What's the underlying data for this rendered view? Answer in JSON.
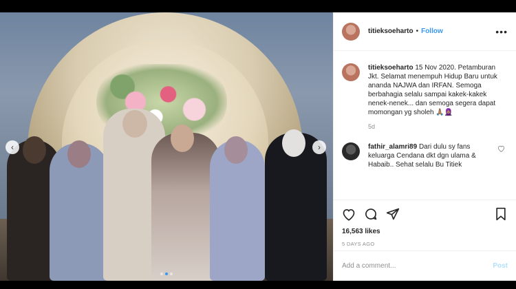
{
  "post": {
    "username": "titieksoeharto",
    "follow_label": "Follow",
    "more_label": "•••",
    "separator": "•"
  },
  "caption": {
    "username": "titieksoeharto",
    "text": "15 Nov 2020. Petamburan Jkt. Selamat menempuh Hidup Baru untuk ananda NAJWA dan IRFAN. Semoga berbahagia selalu sampai kakek-kakek nenek-nenek... dan semoga segera dapat momongan yg sholeh 🙏🏽🧕🏽",
    "time": "5d"
  },
  "comment": {
    "username": "fathir_alamri89",
    "text": "Dari dulu sy fans keluarga Cendana dkt dgn ulama & Habaib.. Sehat selalu Bu Titiek"
  },
  "likes": "16,563 likes",
  "posted_ago": "5 DAYS AGO",
  "add_comment": {
    "placeholder": "Add a comment...",
    "post_label": "Post"
  },
  "carousel": {
    "prev_label": "‹",
    "next_label": "›"
  },
  "icons": {
    "more": "more-dots-icon",
    "like": "heart-icon",
    "comment": "comment-icon",
    "share": "share-icon",
    "save": "bookmark-icon",
    "comment_like": "heart-small-icon"
  },
  "colors": {
    "accent": "#3897f0",
    "text": "#262626",
    "muted": "#8e8e8e",
    "post_disabled": "#b2dffc"
  }
}
